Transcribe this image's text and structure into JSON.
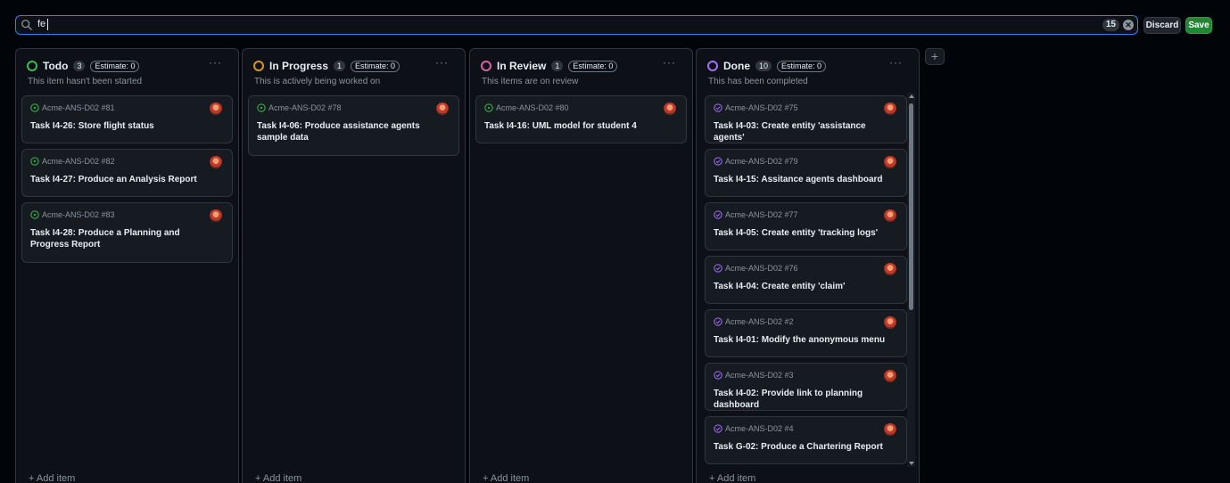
{
  "filter": {
    "query": "fe",
    "count": "15"
  },
  "actions": {
    "discard": "Discard",
    "save": "Save"
  },
  "colors": {
    "todo": "#3fb950",
    "in_progress": "#d29922",
    "in_review": "#db61a2",
    "done": "#a371f7",
    "open_issue": "#3fb950",
    "closed_issue": "#a371f7"
  },
  "add_item_label": "+ Add item",
  "add_column_label": "+",
  "columns": [
    {
      "title": "Todo",
      "count": "3",
      "estimate": "Estimate: 0",
      "description": "This item hasn't been started",
      "cards": [
        {
          "ref": "Acme-ANS-D02 #81",
          "title": "Task I4-26: Store flight status"
        },
        {
          "ref": "Acme-ANS-D02 #82",
          "title": "Task I4-27: Produce an Analysis Report"
        },
        {
          "ref": "Acme-ANS-D02 #83",
          "title": "Task I4-28: Produce a Planning and Progress Report"
        }
      ]
    },
    {
      "title": "In Progress",
      "count": "1",
      "estimate": "Estimate: 0",
      "description": "This is actively being worked on",
      "cards": [
        {
          "ref": "Acme-ANS-D02 #78",
          "title": "Task I4-06: Produce assistance agents sample data"
        }
      ]
    },
    {
      "title": "In Review",
      "count": "1",
      "estimate": "Estimate: 0",
      "description": "This items are on review",
      "cards": [
        {
          "ref": "Acme-ANS-D02 #80",
          "title": "Task I4-16: UML model for student 4"
        }
      ]
    },
    {
      "title": "Done",
      "count": "10",
      "estimate": "Estimate: 0",
      "description": "This has been completed",
      "cards": [
        {
          "ref": "Acme-ANS-D02 #75",
          "title": "Task I4-03: Create entity 'assistance agents'"
        },
        {
          "ref": "Acme-ANS-D02 #79",
          "title": "Task I4-15: Assitance agents dashboard"
        },
        {
          "ref": "Acme-ANS-D02 #77",
          "title": "Task I4-05: Create entity 'tracking logs'"
        },
        {
          "ref": "Acme-ANS-D02 #76",
          "title": "Task I4-04: Create entity 'claim'"
        },
        {
          "ref": "Acme-ANS-D02 #2",
          "title": "Task I4-01: Modify the anonymous menu"
        },
        {
          "ref": "Acme-ANS-D02 #3",
          "title": "Task I4-02: Provide link to planning dashboard"
        },
        {
          "ref": "Acme-ANS-D02 #4",
          "title": "Task G-02: Produce a Chartering Report"
        }
      ]
    }
  ]
}
